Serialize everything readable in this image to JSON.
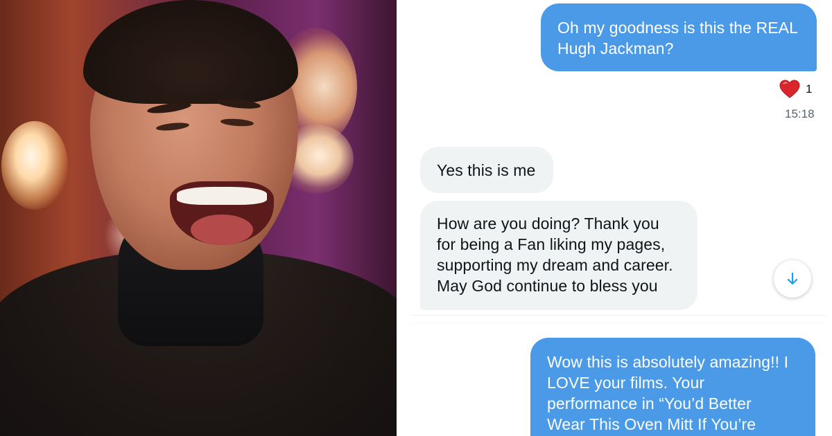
{
  "photo": {
    "description_icon": "person-photo"
  },
  "chat": {
    "messages": [
      {
        "id": "m1",
        "direction": "sent",
        "text": "Oh my goodness is this the REAL\nHugh Jackman?"
      },
      {
        "id": "m2",
        "direction": "received",
        "text": "Yes this is me"
      },
      {
        "id": "m3",
        "direction": "received",
        "text": "How are you doing? Thank you\nfor being a Fan liking my pages,\nsupporting my dream and career.\nMay God continue to bless you"
      },
      {
        "id": "m4",
        "direction": "sent",
        "text": "Wow this is absolutely amazing!! I\nLOVE your films. Your\nperformance in “You’d Better\nWear This Oven Mitt If You’re"
      }
    ],
    "reaction": {
      "icon": "heart-icon",
      "count": "1"
    },
    "timestamp": "15:18",
    "scroll_button_icon": "arrow-down-icon"
  },
  "colors": {
    "sent_bubble": "#4a9ae8",
    "received_bubble": "#eff3f4",
    "heart": "#e0245e",
    "scroll_arrow": "#1d9bf0"
  }
}
